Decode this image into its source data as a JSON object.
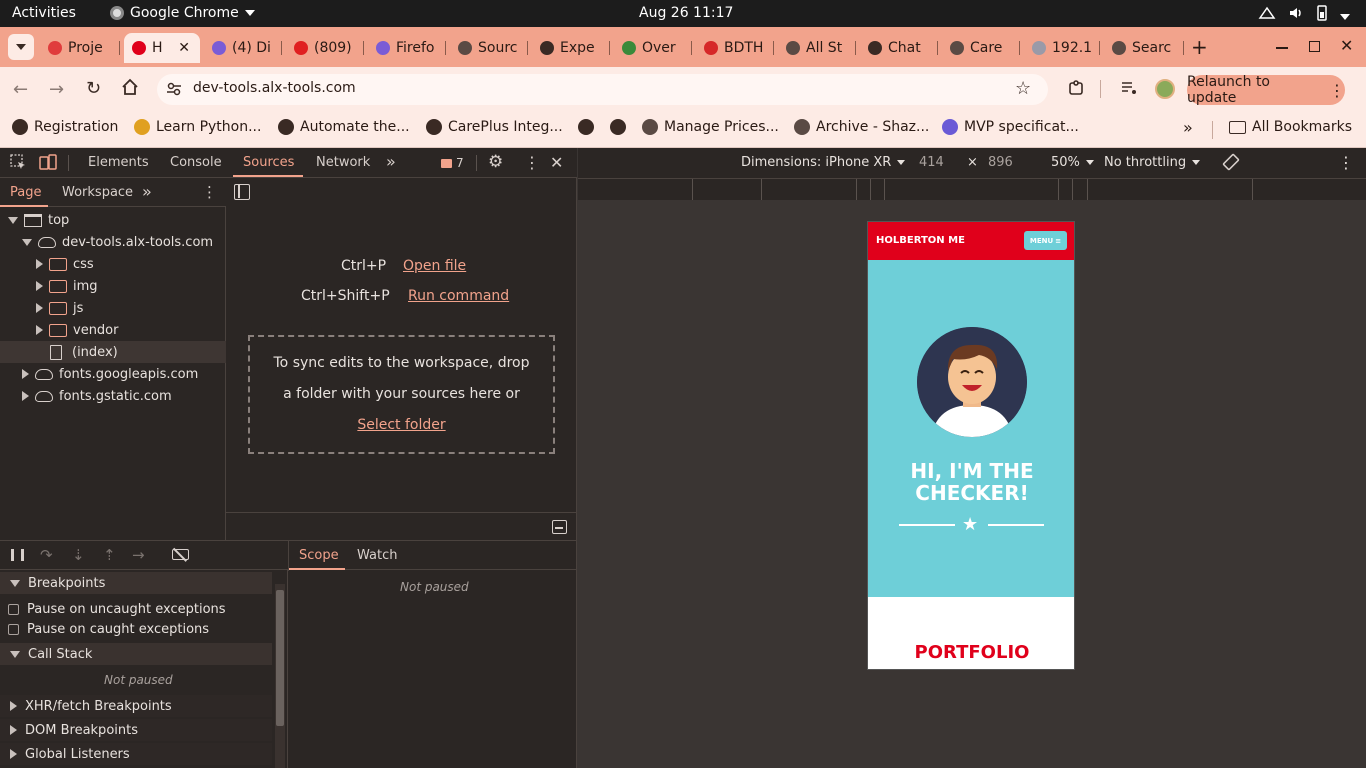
{
  "gnome": {
    "activities": "Activities",
    "app_name": "Google Chrome",
    "clock": "Aug 26  11:17"
  },
  "tabs": [
    {
      "label": "Proje",
      "color": "#e03c3c"
    },
    {
      "label": "H",
      "color": "#e0001b",
      "active": true
    },
    {
      "label": "(4) Di",
      "color": "#7a5cd6"
    },
    {
      "label": "(809)",
      "color": "#e02020"
    },
    {
      "label": "Firefo",
      "color": "#7a5cd6"
    },
    {
      "label": "Sourc",
      "color": "#5a4a44"
    },
    {
      "label": "Expe",
      "color": "#3a2a24"
    },
    {
      "label": "Over",
      "color": "#3a8a3a"
    },
    {
      "label": "BDTH",
      "color": "#d62828"
    },
    {
      "label": "All St",
      "color": "#5a4a44"
    },
    {
      "label": "Chat",
      "color": "#3a2a24"
    },
    {
      "label": "Care",
      "color": "#5a4a44"
    },
    {
      "label": "192.1",
      "color": "#9a9aa8"
    },
    {
      "label": "Searc",
      "color": "#5a4a44"
    }
  ],
  "toolbar": {
    "url": "dev-tools.alx-tools.com",
    "relaunch": "Relaunch to update"
  },
  "bookmarks": [
    {
      "label": "Registration",
      "color": "#3a2a24"
    },
    {
      "label": "Learn Python...",
      "color": "#e0a020"
    },
    {
      "label": "Automate the...",
      "color": "#3a2a24"
    },
    {
      "label": "CarePlus Integ...",
      "color": "#3a2a24"
    },
    {
      "label": "",
      "color": "#3a2a24"
    },
    {
      "label": "",
      "color": "#3a2a24"
    },
    {
      "label": "Manage Prices...",
      "color": "#5a4a44"
    },
    {
      "label": "Archive - Shaz...",
      "color": "#5a4a44"
    },
    {
      "label": "MVP specificat...",
      "color": "#6a5ad6"
    }
  ],
  "all_bookmarks": "All Bookmarks",
  "devtools": {
    "tabs": [
      "Elements",
      "Console",
      "Sources",
      "Network"
    ],
    "issues_count": "7",
    "nav_tabs": [
      "Page",
      "Workspace"
    ],
    "tree": {
      "top": "top",
      "domain": "dev-tools.alx-tools.com",
      "folders": [
        "css",
        "img",
        "js",
        "vendor"
      ],
      "index": "(index)",
      "other_domains": [
        "fonts.googleapis.com",
        "fonts.gstatic.com"
      ]
    },
    "editor": {
      "shortcut1_key": "Ctrl+P",
      "shortcut1_action": "Open file",
      "shortcut2_key": "Ctrl+Shift+P",
      "shortcut2_action": "Run command",
      "drop_line1": "To sync edits to the workspace, drop",
      "drop_line2": "a folder with your sources here or",
      "select_folder": "Select folder"
    },
    "debugger": {
      "breakpoints": "Breakpoints",
      "pause_uncaught": "Pause on uncaught exceptions",
      "pause_caught": "Pause on caught exceptions",
      "call_stack": "Call Stack",
      "not_paused": "Not paused",
      "xhr": "XHR/fetch Breakpoints",
      "dom": "DOM Breakpoints",
      "global": "Global Listeners",
      "scope": "Scope",
      "watch": "Watch",
      "scope_not_paused": "Not paused"
    }
  },
  "device": {
    "dimensions_label": "Dimensions: iPhone XR",
    "width": "414",
    "times": "×",
    "height": "896",
    "zoom": "50%",
    "throttling": "No throttling"
  },
  "site": {
    "brand": "HOLBERTON ME",
    "menu": "MENU",
    "hero_line1": "HI, I'M THE",
    "hero_line2": "CHECKER!",
    "portfolio": "PORTFOLIO",
    "header_color": "#e0001b",
    "hero_color": "#6ecfd8"
  }
}
